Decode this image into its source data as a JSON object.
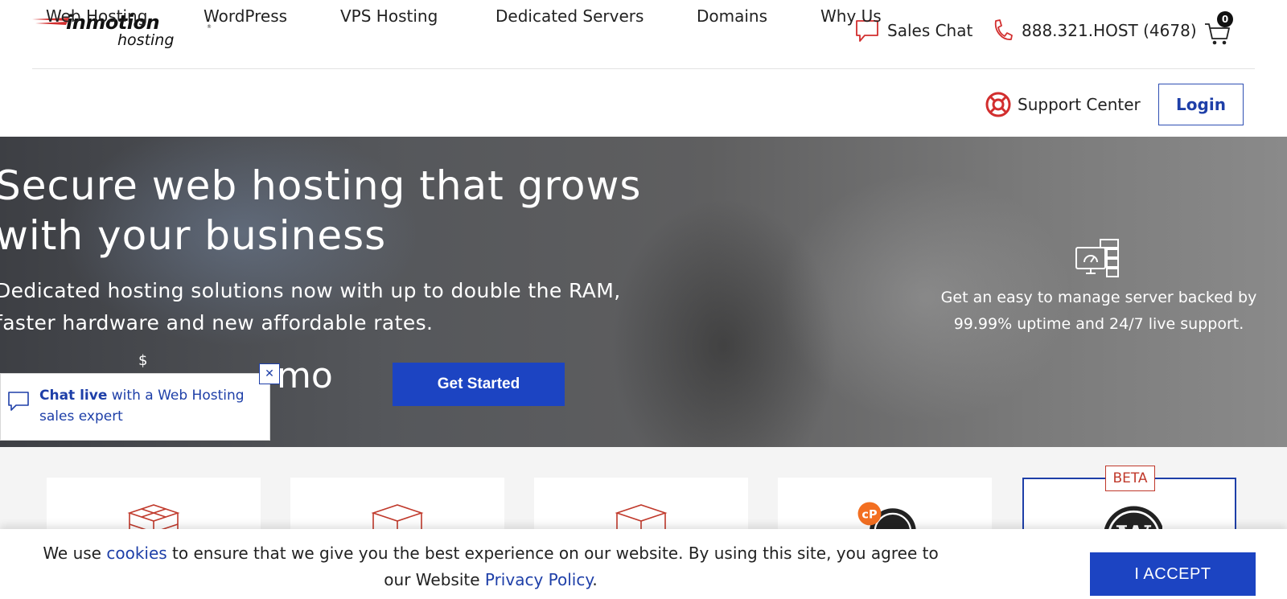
{
  "header": {
    "logo_brand": "inmotion",
    "logo_sub": "hosting",
    "logo_reg": "®",
    "sales_chat_label": "Sales Chat",
    "phone_label": "888.321.HOST (4678)",
    "cart_count": "0"
  },
  "nav": {
    "items": [
      {
        "label": "Web Hosting"
      },
      {
        "label": "WordPress"
      },
      {
        "label": "VPS Hosting"
      },
      {
        "label": "Dedicated Servers"
      },
      {
        "label": "Domains"
      },
      {
        "label": "Why Us"
      }
    ],
    "support_label": "Support Center",
    "login_label": "Login"
  },
  "hero": {
    "title_line1": "Secure web hosting that grows",
    "title_line2": "with your business",
    "sub_line1": "Dedicated hosting solutions now with up to double the RAM,",
    "sub_line2": "faster hardware and new affordable rates.",
    "price_symbol": "$",
    "price_amount": "",
    "price_unit": "mo",
    "cta_label": "Get Started",
    "right_text_line1": "Get an easy to manage server backed by",
    "right_text_line2": "99.99% uptime and 24/7 live support."
  },
  "chat_widget": {
    "bold": "Chat live",
    "rest": " with a Web Hosting sales expert",
    "close_glyph": "✕"
  },
  "cards": {
    "beta_label": "BETA"
  },
  "cookie": {
    "text_before": "We use ",
    "link_cookies": "cookies",
    "text_middle": " to ensure that we give you the best experience on our website. By using this site,  you agree to our Website ",
    "link_privacy": "Privacy Policy",
    "text_after": ".",
    "accept_label": "I ACCEPT"
  },
  "colors": {
    "accent_blue": "#1c44c2",
    "brand_red": "#d22e2e",
    "cpanel_orange": "#f36f21"
  }
}
